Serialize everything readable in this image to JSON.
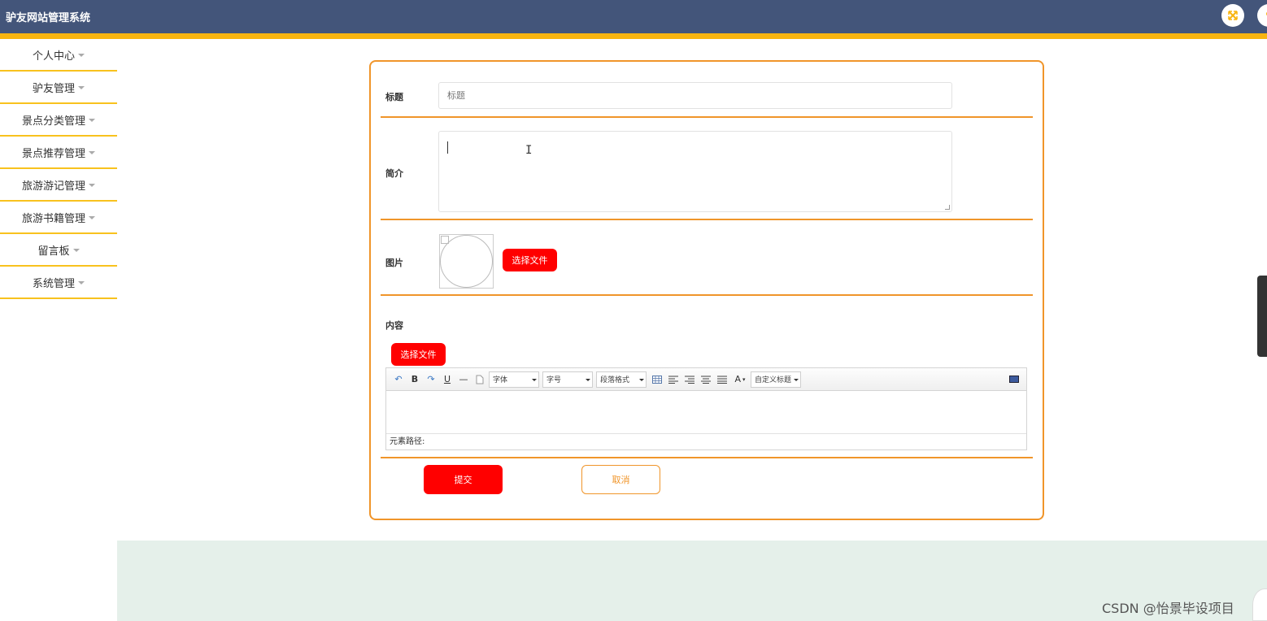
{
  "header": {
    "app_title": "驴友网站管理系统",
    "colors": {
      "topbar": "#43557a",
      "accent": "#f8b40f"
    },
    "icons": [
      "fullscreen-icon",
      "user-icon"
    ]
  },
  "sidebar": {
    "items": [
      {
        "label": "个人中心"
      },
      {
        "label": "驴友管理"
      },
      {
        "label": "景点分类管理"
      },
      {
        "label": "景点推荐管理"
      },
      {
        "label": "旅游游记管理"
      },
      {
        "label": "旅游书籍管理"
      },
      {
        "label": "留言板"
      },
      {
        "label": "系统管理"
      }
    ]
  },
  "form": {
    "title_label": "标题",
    "title_placeholder": "标题",
    "intro_label": "简介",
    "image_label": "图片",
    "image_choose_button": "选择文件",
    "content_label": "内容",
    "content_choose_button": "选择文件",
    "editor": {
      "font_select": "字体",
      "size_select": "字号",
      "paragraph_select": "段落格式",
      "custom_heading_select": "自定义标题",
      "status_text": "元素路径:"
    },
    "submit_button": "提交",
    "cancel_button": "取消",
    "colors": {
      "border": "#f0952a",
      "primary_button": "#ff0000"
    }
  },
  "watermark": "CSDN @怡景毕设项目"
}
